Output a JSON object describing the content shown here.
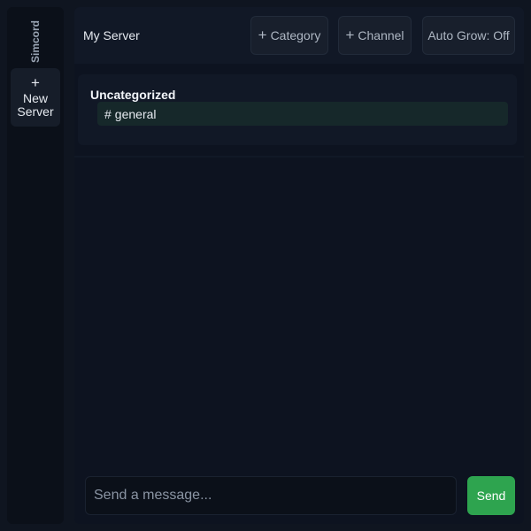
{
  "app": {
    "name": "Simcord"
  },
  "rail": {
    "new_server": {
      "icon": "plus-icon",
      "icon_glyph": "+",
      "label": "New Server"
    }
  },
  "header": {
    "server_title": "My Server",
    "add_category": {
      "icon_glyph": "+",
      "label": "Category"
    },
    "add_channel": {
      "icon_glyph": "+",
      "label": "Channel"
    },
    "auto_grow": "Auto Grow: Off"
  },
  "categories": [
    {
      "name": "Uncategorized",
      "channels": [
        {
          "prefix": "#",
          "name": "general",
          "selected": true
        }
      ]
    }
  ],
  "composer": {
    "placeholder": "Send a message...",
    "value": "",
    "send_label": "Send"
  },
  "colors": {
    "accent": "#2ea44f",
    "background": "#0f1520",
    "selected_channel": "#16282a"
  }
}
